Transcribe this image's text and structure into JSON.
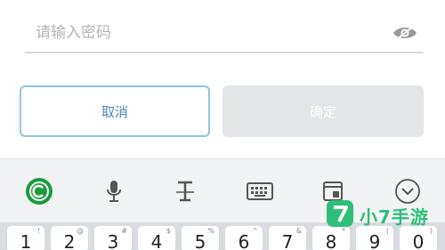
{
  "password": {
    "placeholder": "请输入密码",
    "value": ""
  },
  "buttons": {
    "cancel_label": "取消",
    "confirm_label": "确定"
  },
  "keyboard": {
    "toolbar": [
      "app-logo-icon",
      "microphone-icon",
      "text-cursor-icon",
      "keyboard-icon",
      "clipboard-icon",
      "collapse-keyboard-icon"
    ],
    "keys": [
      {
        "main": "1",
        "sub": "!"
      },
      {
        "main": "2",
        "sub": "@"
      },
      {
        "main": "3",
        "sub": "#"
      },
      {
        "main": "4",
        "sub": "$"
      },
      {
        "main": "5",
        "sub": "%"
      },
      {
        "main": "6",
        "sub": "^"
      },
      {
        "main": "7",
        "sub": "&"
      },
      {
        "main": "8",
        "sub": "*"
      },
      {
        "main": "9",
        "sub": "("
      },
      {
        "main": "0",
        "sub": ")"
      }
    ]
  },
  "watermark": {
    "text": "小7手游",
    "color": "#2dbf7a"
  },
  "colors": {
    "cancel_border": "#8ec5de",
    "confirm_bg": "#e4e5e7",
    "keyboard_bg": "#e9ebee"
  }
}
